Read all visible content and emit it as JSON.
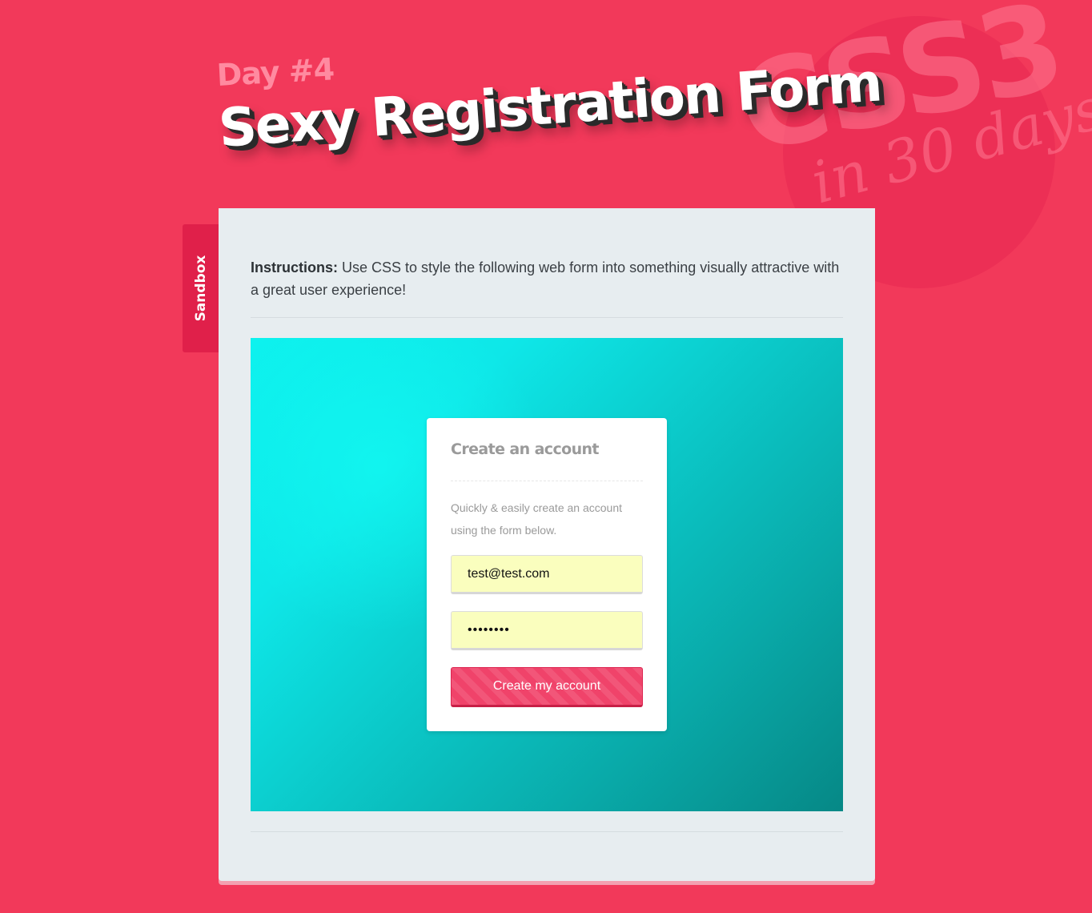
{
  "colors": {
    "page_background": "#f2395a",
    "panel_background": "#e7edf0",
    "sandbox_tab": "#e0204a",
    "stage_gradient_start": "#0df2ee",
    "stage_gradient_end": "#068886",
    "button_accent": "#f0436a",
    "input_background": "#fafebe"
  },
  "badge": {
    "main_text": "CSS3",
    "sub_text": "in 30 days"
  },
  "header": {
    "day": "Day #4",
    "title": "Sexy Registration Form"
  },
  "sandbox_tab": {
    "label": "Sandbox"
  },
  "instructions": {
    "label": "Instructions:",
    "text": " Use CSS to style the following web form into something visually attractive with a great user experience!"
  },
  "form": {
    "title": "Create an account",
    "description": "Quickly & easily create an account using the form below.",
    "email_value": "test@test.com",
    "password_value": "testtest",
    "submit_label": "Create my account"
  }
}
